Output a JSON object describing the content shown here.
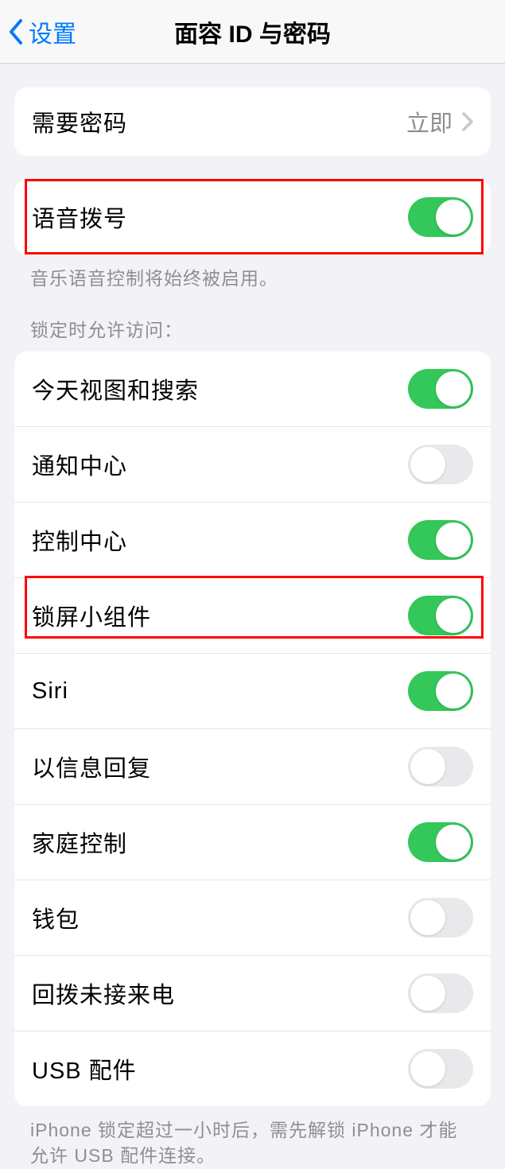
{
  "nav": {
    "back_label": "设置",
    "title": "面容 ID 与密码"
  },
  "require_passcode": {
    "label": "需要密码",
    "value": "立即"
  },
  "voice_dial": {
    "label": "语音拨号",
    "footer": "音乐语音控制将始终被启用。",
    "enabled": true
  },
  "lock_access": {
    "header": "锁定时允许访问：",
    "items": [
      {
        "label": "今天视图和搜索",
        "enabled": true
      },
      {
        "label": "通知中心",
        "enabled": false
      },
      {
        "label": "控制中心",
        "enabled": true
      },
      {
        "label": "锁屏小组件",
        "enabled": true
      },
      {
        "label": "Siri",
        "enabled": true
      },
      {
        "label": "以信息回复",
        "enabled": false
      },
      {
        "label": "家庭控制",
        "enabled": true
      },
      {
        "label": "钱包",
        "enabled": false
      },
      {
        "label": "回拨未接来电",
        "enabled": false
      },
      {
        "label": "USB 配件",
        "enabled": false
      }
    ],
    "footer": "iPhone 锁定超过一小时后，需先解锁 iPhone 才能允许 USB 配件连接。"
  }
}
